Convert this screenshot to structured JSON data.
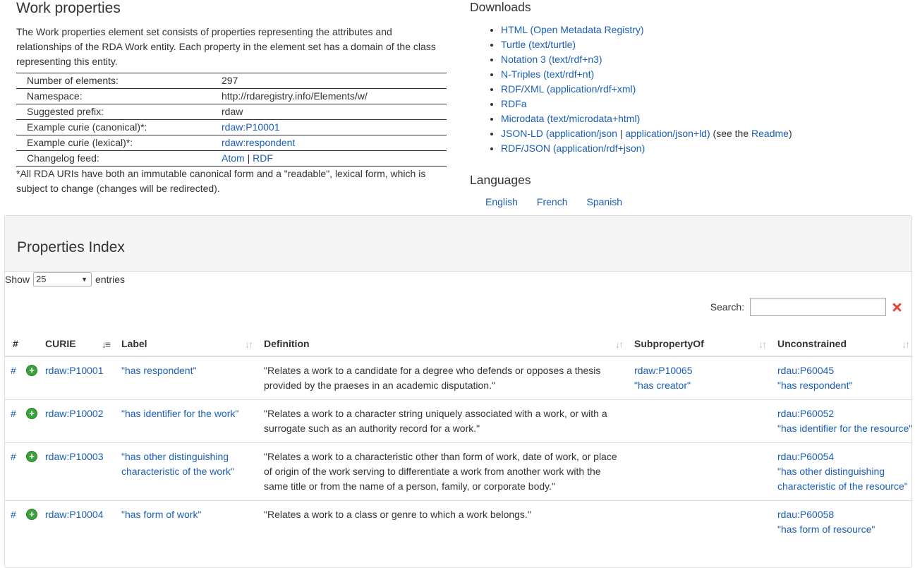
{
  "work": {
    "title": "Work properties",
    "intro": "The Work properties element set consists of properties representing the attributes and relationships of the RDA Work entity. Each property in the element set has a domain of the class representing this entity.",
    "meta": {
      "elements_label": "Number of elements:",
      "elements_value": "297",
      "namespace_label": "Namespace:",
      "namespace_value": "http://rdaregistry.info/Elements/w/",
      "prefix_label": "Suggested prefix:",
      "prefix_value": "rdaw",
      "curie_canonical_label": "Example curie (canonical)*:",
      "curie_canonical_value": "rdaw:P10001",
      "curie_lexical_label": "Example curie (lexical)*:",
      "curie_lexical_value": "rdaw:respondent",
      "changelog_label": "Changelog feed:",
      "changelog_atom": "Atom",
      "changelog_sep": "|",
      "changelog_rdf": "RDF"
    },
    "footnote": "*All RDA URIs have both an immutable canonical form and a \"readable\", lexical form, which is subject to change (changes will be redirected)."
  },
  "downloads": {
    "heading": "Downloads",
    "items": [
      "HTML (Open Metadata Registry)",
      "Turtle (text/turtle)",
      "Notation 3 (text/rdf+n3)",
      "N-Triples (text/rdf+nt)",
      "RDF/XML (application/rdf+xml)",
      "RDFa",
      "Microdata (text/microdata+html)"
    ],
    "jsonld_link1": "JSON-LD (application/json",
    "jsonld_sep": " | ",
    "jsonld_link2": "application/json+ld)",
    "jsonld_see": " (see the ",
    "jsonld_readme": "Readme",
    "jsonld_close": ")",
    "rdfjson": "RDF/JSON (application/rdf+json)"
  },
  "languages": {
    "heading": "Languages",
    "items": [
      "English",
      "French",
      "Spanish"
    ]
  },
  "index": {
    "title": "Properties Index",
    "show_label": "Show",
    "show_value": "25",
    "entries_label": "entries",
    "search_label": "Search:",
    "columns": {
      "num": "#",
      "curie": "CURIE",
      "label": "Label",
      "definition": "Definition",
      "subproperty": "SubpropertyOf",
      "unconstrained": "Unconstrained"
    },
    "rows": [
      {
        "hash": "#",
        "curie": "rdaw:P10001",
        "label": "\"has respondent\"",
        "definition": "\"Relates a work to a candidate for a degree who defends or opposes a thesis provided by the praeses in an academic disputation.\"",
        "sub_curie": "rdaw:P10065",
        "sub_label": "\"has creator\"",
        "un_curie": "rdau:P60045",
        "un_label": "\"has respondent\""
      },
      {
        "hash": "#",
        "curie": "rdaw:P10002",
        "label": "\"has identifier for the work\"",
        "definition": "\"Relates a work to a character string uniquely associated with a work, or with a surrogate such as an authority record for a work.\"",
        "sub_curie": "",
        "sub_label": "",
        "un_curie": "rdau:P60052",
        "un_label": "\"has identifier for the resource\""
      },
      {
        "hash": "#",
        "curie": "rdaw:P10003",
        "label": "\"has other distinguishing characteristic of the work\"",
        "definition": "\"Relates a work to a characteristic other than form of work, date of work, or place of origin of the work serving to differentiate a work from another work with the same title or from the name of a person, family, or corporate body.\"",
        "sub_curie": "",
        "sub_label": "",
        "un_curie": "rdau:P60054",
        "un_label": "\"has other distinguishing characteristic of the resource\""
      },
      {
        "hash": "#",
        "curie": "rdaw:P10004",
        "label": "\"has form of work\"",
        "definition": "\"Relates a work to a class or genre to which a work belongs.\"",
        "sub_curie": "",
        "sub_label": "",
        "un_curie": "rdau:P60058",
        "un_label": "\"has form of resource\""
      }
    ]
  },
  "icons": {
    "expand": "plus-circle-icon",
    "clear": "close-icon",
    "sort": "sort-icon"
  },
  "colors": {
    "link": "#1a5eb8",
    "expand_icon": "#3aa23a",
    "clear_icon": "#e04a3a",
    "panel_header": "#f5f5f5"
  }
}
